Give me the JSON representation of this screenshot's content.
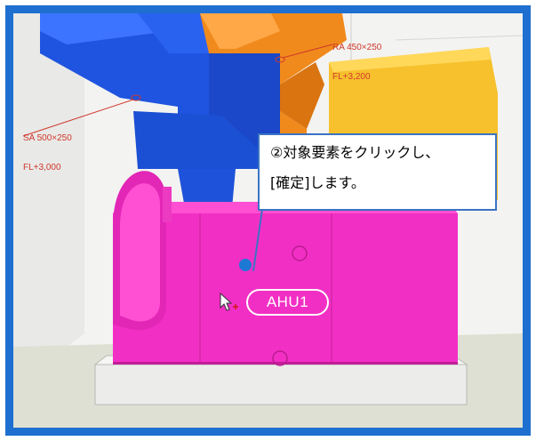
{
  "colors": {
    "frame_border": "#1e6fd0",
    "duct_sa": "#1f54e0",
    "duct_ra": "#f08a1c",
    "unit_body": "#f22fc4",
    "callout_border": "#3b73c4",
    "annotation_red": "#d0382a"
  },
  "viewport": {
    "annotations": {
      "sa": {
        "line1": "SA 500×250",
        "line2": "FL+3,000"
      },
      "ra": {
        "line1": "RA 450×250",
        "line2": "FL+3,200"
      }
    },
    "equipment_label": "AHU1",
    "cursor_icon": "arrow-cursor-with-plus-icon"
  },
  "callout": {
    "line1": "②対象要素をクリックし、",
    "line2": "[確定]します。"
  }
}
